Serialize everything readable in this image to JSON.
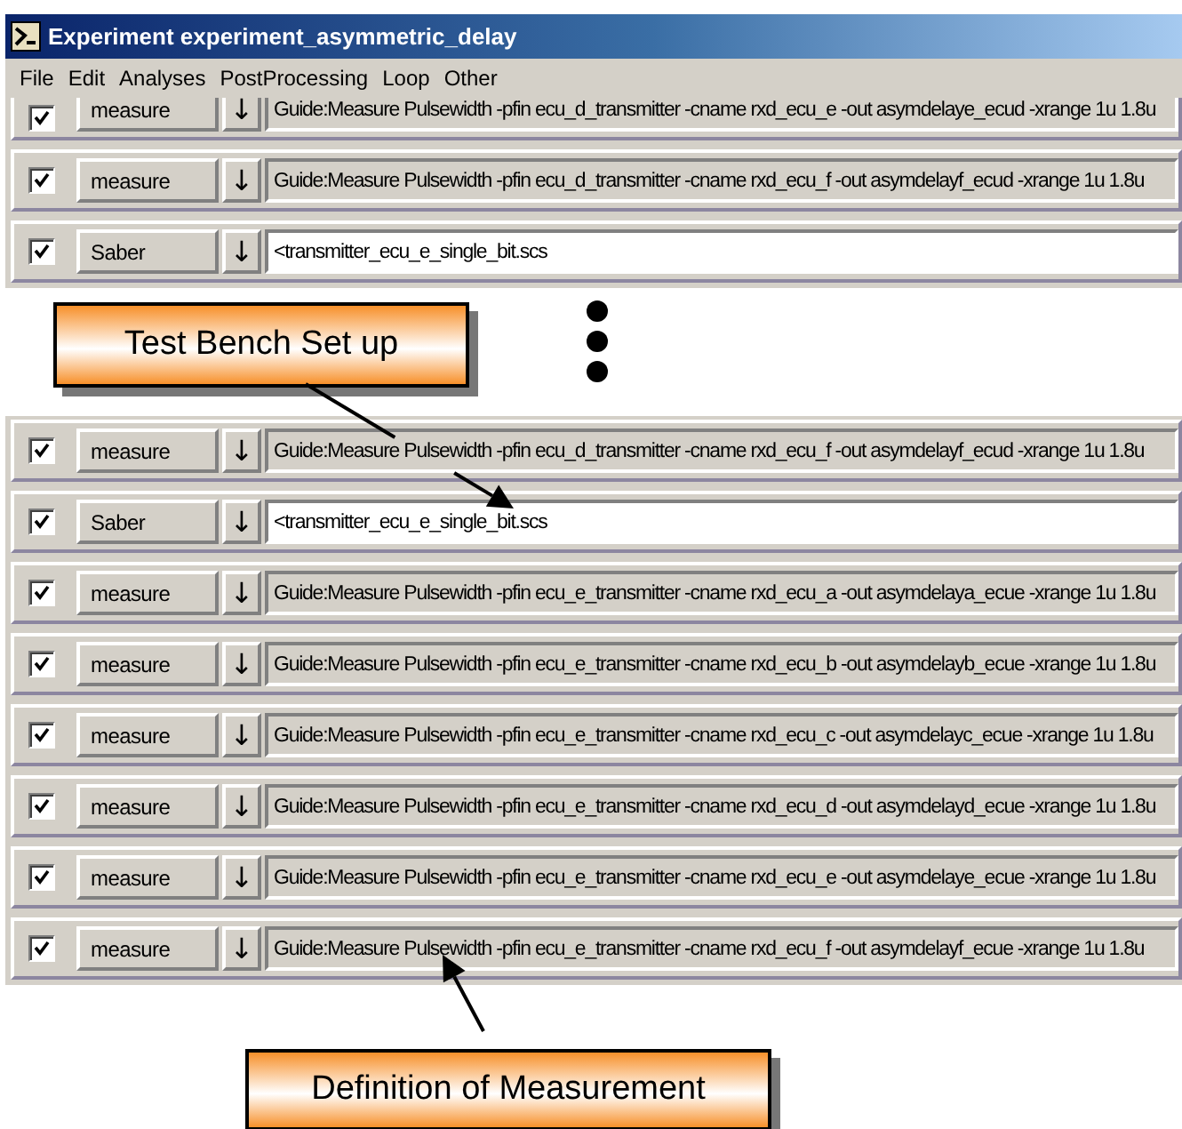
{
  "window": {
    "title": "Experiment experiment_asymmetric_delay"
  },
  "menu": [
    "File",
    "Edit",
    "Analyses",
    "PostProcessing",
    "Loop",
    "Other"
  ],
  "top_rows": [
    {
      "checked": true,
      "tool": "measure",
      "kind": "command",
      "arrow": "↓",
      "text": "Guide:Measure Pulsewidth -pfin ecu_d_transmitter -cname rxd_ecu_e -out asymdelaye_ecud -xrange 1u 1.8u",
      "clipped": true
    },
    {
      "checked": true,
      "tool": "measure",
      "kind": "command",
      "arrow": "↓",
      "text": "Guide:Measure Pulsewidth -pfin ecu_d_transmitter -cname rxd_ecu_f -out asymdelayf_ecud -xrange 1u 1.8u",
      "clipped": false
    },
    {
      "checked": true,
      "tool": "Saber",
      "kind": "file",
      "arrow": "↓",
      "text": "<transmitter_ecu_e_single_bit.scs",
      "clipped": false
    }
  ],
  "callouts": [
    {
      "text": "Test Bench Set up"
    },
    {
      "text": "Definition of Measurement"
    }
  ],
  "bottom_rows": [
    {
      "checked": true,
      "tool": "measure",
      "kind": "command",
      "arrow": "↓",
      "text": "Guide:Measure Pulsewidth -pfin ecu_d_transmitter -cname rxd_ecu_f -out asymdelayf_ecud -xrange 1u 1.8u",
      "clipped": false
    },
    {
      "checked": true,
      "tool": "Saber",
      "kind": "file",
      "arrow": "↓",
      "text": "<transmitter_ecu_e_single_bit.scs",
      "clipped": false
    },
    {
      "checked": true,
      "tool": "measure",
      "kind": "command",
      "arrow": "↓",
      "text": "Guide:Measure Pulsewidth -pfin ecu_e_transmitter -cname rxd_ecu_a -out asymdelaya_ecue -xrange 1u 1.8u",
      "clipped": false
    },
    {
      "checked": true,
      "tool": "measure",
      "kind": "command",
      "arrow": "↓",
      "text": "Guide:Measure Pulsewidth -pfin ecu_e_transmitter -cname rxd_ecu_b -out asymdelayb_ecue -xrange 1u 1.8u",
      "clipped": false
    },
    {
      "checked": true,
      "tool": "measure",
      "kind": "command",
      "arrow": "↓",
      "text": "Guide:Measure Pulsewidth -pfin ecu_e_transmitter -cname rxd_ecu_c -out asymdelayc_ecue -xrange 1u 1.8u",
      "clipped": false
    },
    {
      "checked": true,
      "tool": "measure",
      "kind": "command",
      "arrow": "↓",
      "text": "Guide:Measure Pulsewidth -pfin ecu_e_transmitter -cname rxd_ecu_d -out asymdelayd_ecue -xrange 1u 1.8u",
      "clipped": false
    },
    {
      "checked": true,
      "tool": "measure",
      "kind": "command",
      "arrow": "↓",
      "text": "Guide:Measure Pulsewidth -pfin ecu_e_transmitter -cname rxd_ecu_e -out asymdelaye_ecue -xrange 1u 1.8u",
      "clipped": false
    },
    {
      "checked": true,
      "tool": "measure",
      "kind": "command",
      "arrow": "↓",
      "text": "Guide:Measure Pulsewidth -pfin ecu_e_transmitter -cname rxd_ecu_f -out asymdelayf_ecue -xrange 1u 1.8u",
      "clipped": false
    }
  ]
}
